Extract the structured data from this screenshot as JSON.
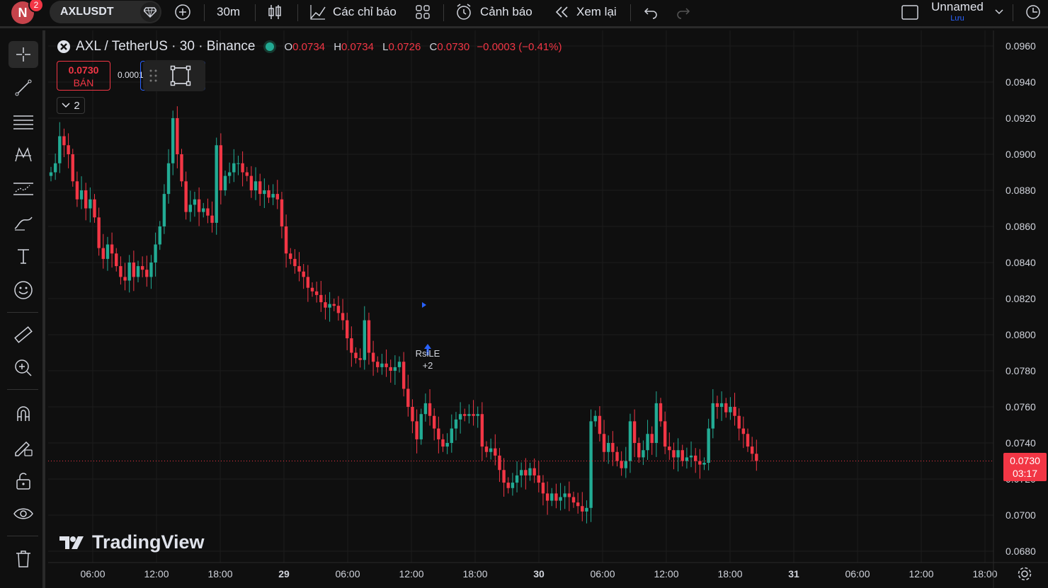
{
  "header": {
    "avatar_letter": "N",
    "notification_count": "2",
    "symbol": "AXLUSDT",
    "interval": "30m",
    "indicators_label": "Các chỉ báo",
    "alerts_label": "Cảnh báo",
    "replay_label": "Xem lại",
    "layout_name": "Unnamed",
    "save_label": "Lưu"
  },
  "legend": {
    "title": "AXL / TetherUS · 30 · Binance",
    "o_label": "O",
    "o": "0.0734",
    "h_label": "H",
    "h": "0.0734",
    "l_label": "L",
    "l": "0.0726",
    "c_label": "C",
    "c": "0.0730",
    "change": "−0.0003 (−0.41%)",
    "sell_price": "0.0730",
    "sell_label": "BÁN",
    "spread": "0.0001",
    "collapse_count": "2"
  },
  "annotation": {
    "name": "RsiLE",
    "extra": "+2"
  },
  "watermark": "TradingView",
  "price_label": {
    "value": "0.0730",
    "countdown": "03:17"
  },
  "colors": {
    "up": "#22ab94",
    "down": "#f23645",
    "background": "#0f0f0f",
    "grid": "#1c1c1c"
  },
  "chart_data": {
    "type": "candlestick",
    "y_ticks": [
      "0.0960",
      "0.0940",
      "0.0920",
      "0.0900",
      "0.0880",
      "0.0860",
      "0.0840",
      "0.0820",
      "0.0800",
      "0.0780",
      "0.0760",
      "0.0740",
      "0.0720",
      "0.0700",
      "0.0680"
    ],
    "ylim": [
      0.0677,
      0.0966
    ],
    "x_ticks": [
      "06:00",
      "12:00",
      "18:00",
      "29",
      "06:00",
      "12:00",
      "18:00",
      "30",
      "06:00",
      "12:00",
      "18:00",
      "31",
      "06:00",
      "12:00",
      "18:00"
    ],
    "last_price": 0.073,
    "closes": [
      0.089,
      0.0895,
      0.091,
      0.0905,
      0.09,
      0.0885,
      0.0875,
      0.088,
      0.087,
      0.0875,
      0.0865,
      0.0848,
      0.0842,
      0.085,
      0.0845,
      0.0838,
      0.0832,
      0.083,
      0.084,
      0.0832,
      0.0838,
      0.0836,
      0.0832,
      0.084,
      0.085,
      0.086,
      0.0878,
      0.0895,
      0.092,
      0.09,
      0.0885,
      0.0868,
      0.0872,
      0.0875,
      0.0868,
      0.087,
      0.0866,
      0.0862,
      0.0905,
      0.088,
      0.0888,
      0.089,
      0.0895,
      0.0895,
      0.089,
      0.0888,
      0.088,
      0.0885,
      0.0878,
      0.088,
      0.0876,
      0.0878,
      0.0875,
      0.086,
      0.0845,
      0.0842,
      0.0838,
      0.0835,
      0.0832,
      0.0826,
      0.0824,
      0.0822,
      0.0818,
      0.0815,
      0.0817,
      0.0816,
      0.0812,
      0.0808,
      0.0798,
      0.079,
      0.0787,
      0.0786,
      0.0808,
      0.079,
      0.0785,
      0.0782,
      0.0784,
      0.0782,
      0.078,
      0.0782,
      0.0785,
      0.077,
      0.076,
      0.0752,
      0.0742,
      0.0756,
      0.0762,
      0.0755,
      0.0748,
      0.0742,
      0.0738,
      0.074,
      0.0748,
      0.0753,
      0.0756,
      0.0755,
      0.0756,
      0.0755,
      0.0756,
      0.0738,
      0.0735,
      0.0737,
      0.0733,
      0.0725,
      0.0718,
      0.0715,
      0.0718,
      0.0722,
      0.0725,
      0.0722,
      0.0726,
      0.0722,
      0.0718,
      0.0712,
      0.0708,
      0.0712,
      0.0708,
      0.071,
      0.0712,
      0.071,
      0.0707,
      0.0705,
      0.0702,
      0.0704,
      0.0752,
      0.0755,
      0.0745,
      0.0735,
      0.074,
      0.0735,
      0.073,
      0.0726,
      0.073,
      0.0752,
      0.074,
      0.0732,
      0.0736,
      0.0745,
      0.074,
      0.0762,
      0.0752,
      0.0738,
      0.0736,
      0.0732,
      0.0736,
      0.073,
      0.0732,
      0.0733,
      0.073,
      0.0728,
      0.0729,
      0.0748,
      0.0762,
      0.076,
      0.0762,
      0.0757,
      0.076,
      0.0755,
      0.0748,
      0.0745,
      0.0738,
      0.0734,
      0.073
    ]
  }
}
